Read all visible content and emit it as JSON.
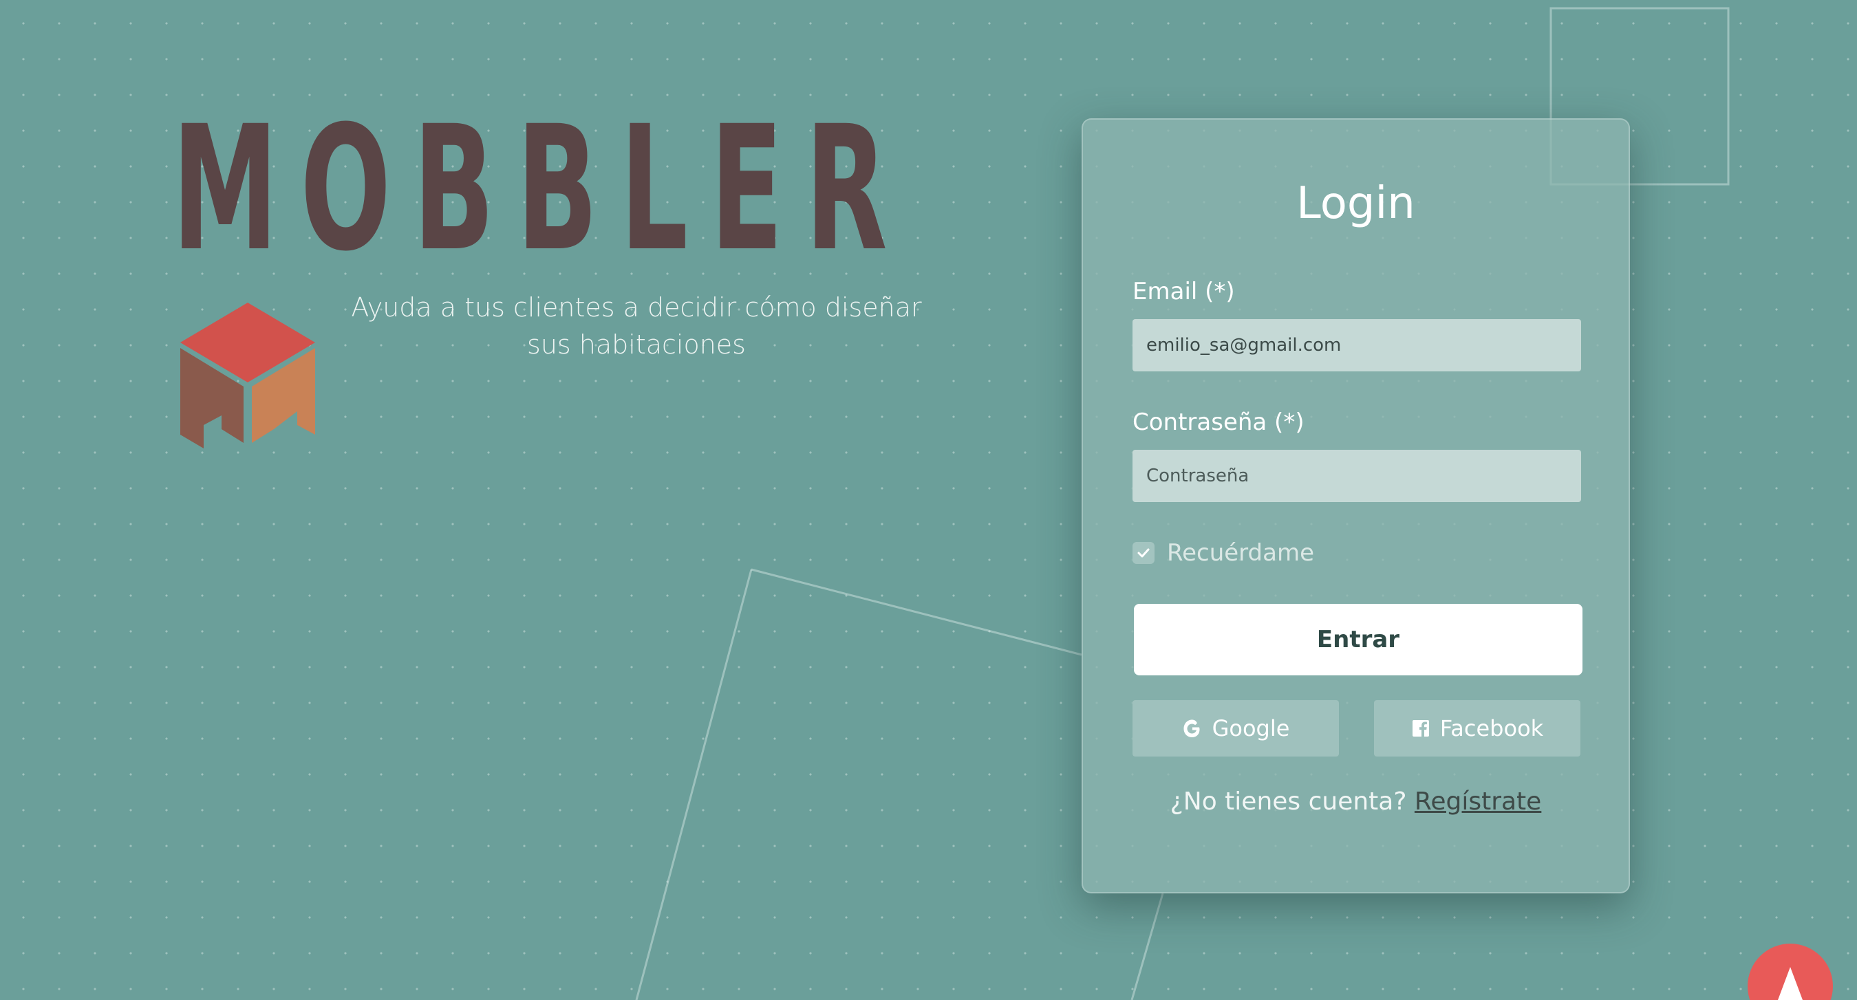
{
  "brand": {
    "name": "MOBBLER",
    "tagline_line1": "Ayuda a tus clientes a decidir cómo diseñar",
    "tagline_line2": "sus habitaciones",
    "logo_icon": "cube-logo-icon",
    "colors": {
      "title": "#5a4546",
      "cube_top": "#d2524c",
      "cube_left": "#8a5a4c",
      "cube_right": "#c98256"
    }
  },
  "login": {
    "title": "Login",
    "email": {
      "label": "Email (*)",
      "value": "emilio_sa@gmail.com"
    },
    "password": {
      "label": "Contraseña (*)",
      "placeholder": "Contraseña"
    },
    "remember": {
      "label": "Recuérdame",
      "checked": true,
      "icon": "check-icon"
    },
    "submit_label": "Entrar",
    "social": {
      "google_label": "Google",
      "google_icon": "google-icon",
      "facebook_label": "Facebook",
      "facebook_icon": "facebook-icon"
    },
    "signup_prompt": "¿No tienes cuenta?",
    "signup_link": "Regístrate"
  },
  "fab": {
    "icon": "arrow-up-icon",
    "color": "#e85a58"
  },
  "theme": {
    "background": "#6b9f9a",
    "card": "#8cb4af",
    "input": "#c5d9d6"
  }
}
